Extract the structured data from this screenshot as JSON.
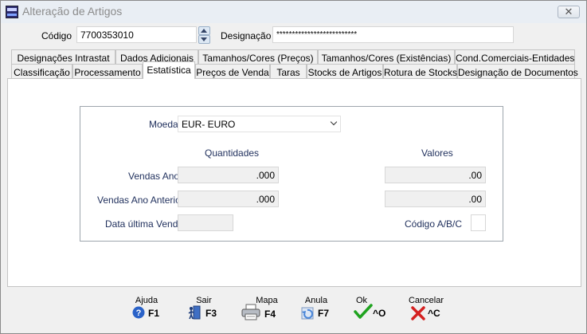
{
  "window": {
    "title": "Alteração de Artigos",
    "close_glyph": "✕"
  },
  "header": {
    "codigo_label": "Código",
    "codigo_value": "7700353010",
    "designacao_label": "Designação",
    "designacao_value": "**************************"
  },
  "tabs_row1": [
    "Designações Intrastat",
    "Dados Adicionais",
    "Tamanhos/Cores (Preços)",
    "Tamanhos/Cores (Existências)",
    "Cond.Comerciais-Entidades"
  ],
  "tabs_row2": [
    "Classificação",
    "Processamento",
    "Estatística",
    "Preços de Venda",
    "Taras",
    "Stocks de Artigos",
    "Rotura de Stocks",
    "Designação de Documentos"
  ],
  "active_tab": "Estatística",
  "stats": {
    "moeda_label": "Moeda",
    "moeda_value": "EUR-  EURO",
    "quantidades_header": "Quantidades",
    "valores_header": "Valores",
    "vendas_ano_label": "Vendas Ano",
    "vendas_ano_qty": ".000",
    "vendas_ano_val": ".00",
    "vendas_ano_ant_label": "Vendas Ano Anterior",
    "vendas_ano_ant_qty": ".000",
    "vendas_ano_ant_val": ".00",
    "data_ultima_label": "Data última Venda",
    "data_ultima_value": "",
    "codigo_abc_label": "Código A/B/C",
    "codigo_abc_value": ""
  },
  "toolbar": {
    "ajuda": {
      "label": "Ajuda",
      "key": "F1",
      "icon": "help-icon"
    },
    "sair": {
      "label": "Sair",
      "key": "F3",
      "icon": "exit-door-icon"
    },
    "mapa": {
      "label": "Mapa",
      "key": "F4",
      "icon": "printer-icon"
    },
    "anula": {
      "label": "Anula",
      "key": "F7",
      "icon": "undo-icon"
    },
    "ok": {
      "label": "Ok",
      "key": "^O",
      "icon": "checkmark-icon"
    },
    "cancelar": {
      "label": "Cancelar",
      "key": "^C",
      "icon": "cross-icon"
    }
  },
  "colors": {
    "label_navy": "#1f2f5c",
    "ok_green": "#1fa31f",
    "cancel_red": "#d42020"
  }
}
